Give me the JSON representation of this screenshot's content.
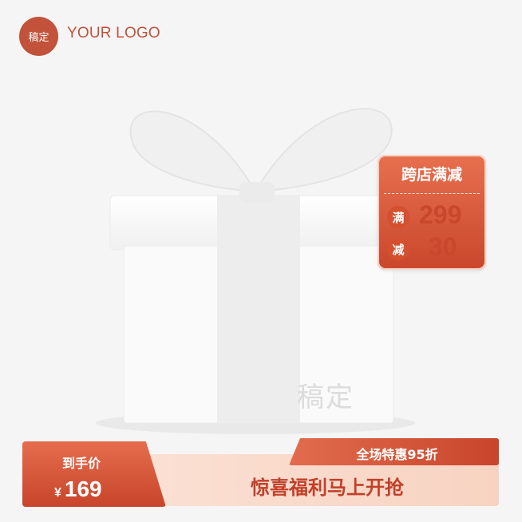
{
  "logo": {
    "badge_text": "稿定",
    "text": "YOUR LOGO"
  },
  "watermark": "稿定",
  "promo": {
    "title": "跨店满减",
    "rows": [
      {
        "badge": "满",
        "value": "299"
      },
      {
        "badge": "减",
        "value": "30"
      }
    ]
  },
  "banner": {
    "discount": "全场特惠95折",
    "slogan": "惊喜福利马上开抢",
    "price_label": "到手价",
    "currency": "¥",
    "price": "169"
  },
  "colors": {
    "accent": "#c9472c",
    "light": "#fbe4d8",
    "background": "#f5f5f6"
  },
  "icons": {
    "product": "gift-box-icon"
  }
}
